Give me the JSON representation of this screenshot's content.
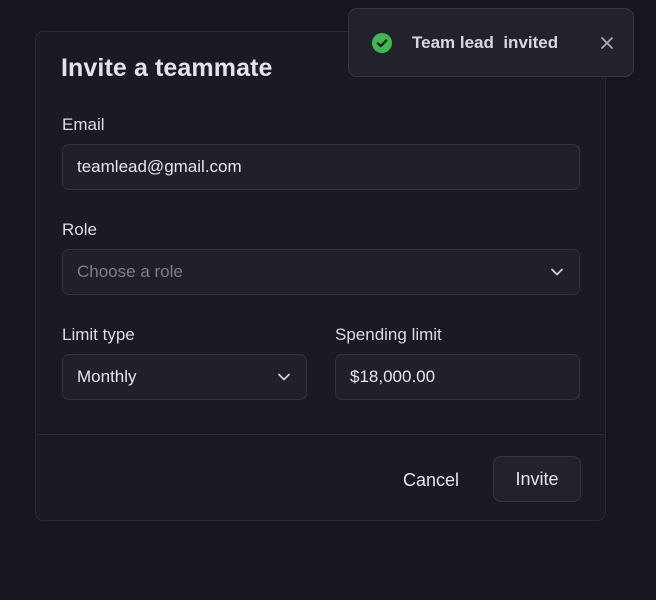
{
  "dialog": {
    "title": "Invite a teammate",
    "email": {
      "label": "Email",
      "value": "teamlead@gmail.com"
    },
    "role": {
      "label": "Role",
      "placeholder": "Choose a role",
      "icon": "chevron-down-icon"
    },
    "limit_type": {
      "label": "Limit type",
      "value": "Monthly",
      "icon": "chevron-down-icon"
    },
    "spending_limit": {
      "label": "Spending limit",
      "value": "$18,000.00"
    },
    "cancel_label": "Cancel",
    "invite_label": "Invite"
  },
  "toast": {
    "message": "Team lead  invited",
    "icon": "check-circle-icon",
    "close_icon": "close-icon",
    "success_color": "#3fb950"
  },
  "colors": {
    "background": "#16161e",
    "dialog_background": "#1a1a23",
    "input_background": "#20202b"
  }
}
